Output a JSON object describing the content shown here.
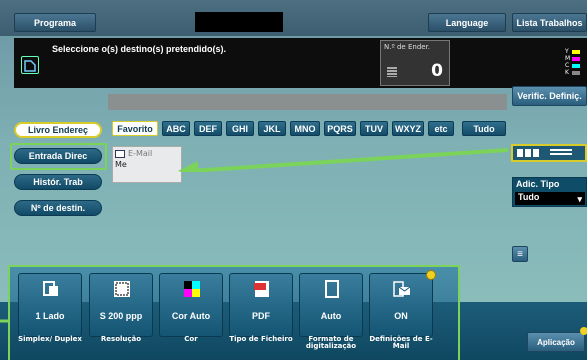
{
  "top": {
    "programa": "Programa",
    "language": "Language",
    "lista": "Lista Trabalhos"
  },
  "message": {
    "text": "Seleccione o(s) destino(s) pretendido(s).",
    "count_label": "N.º de Ender.",
    "count": "0",
    "toner": [
      "Y",
      "M",
      "C",
      "K"
    ]
  },
  "verif_label": "Verific. Definiç.",
  "side": {
    "items": [
      "Livro Endereç",
      "Entrada Direc",
      "Histór. Trab",
      "Nº de destin."
    ]
  },
  "tabs": [
    "Favorito",
    "ABC",
    "DEF",
    "GHI",
    "JKL",
    "MNO",
    "PQRS",
    "TUV",
    "WXYZ",
    "etc",
    "Tudo"
  ],
  "entry": {
    "type": "E-Mail",
    "name": "Me"
  },
  "adic": {
    "label": "Adic. Tipo",
    "value": "Tudo"
  },
  "tiles": [
    {
      "value": "1 Lado",
      "label": "Simplex/ Duplex"
    },
    {
      "value": "S 200 ppp",
      "label": "Resolução"
    },
    {
      "value": "Cor Auto",
      "label": "Cor"
    },
    {
      "value": "PDF",
      "label": "Tipo de Ficheiro"
    },
    {
      "value": "Auto",
      "label": "Formato de digitalização"
    },
    {
      "value": "ON",
      "label": "Definições de E-Mail"
    }
  ],
  "aplic": "Aplicação",
  "colors": {
    "accent": "#d8cc2a",
    "highlight": "#7bd35a"
  }
}
